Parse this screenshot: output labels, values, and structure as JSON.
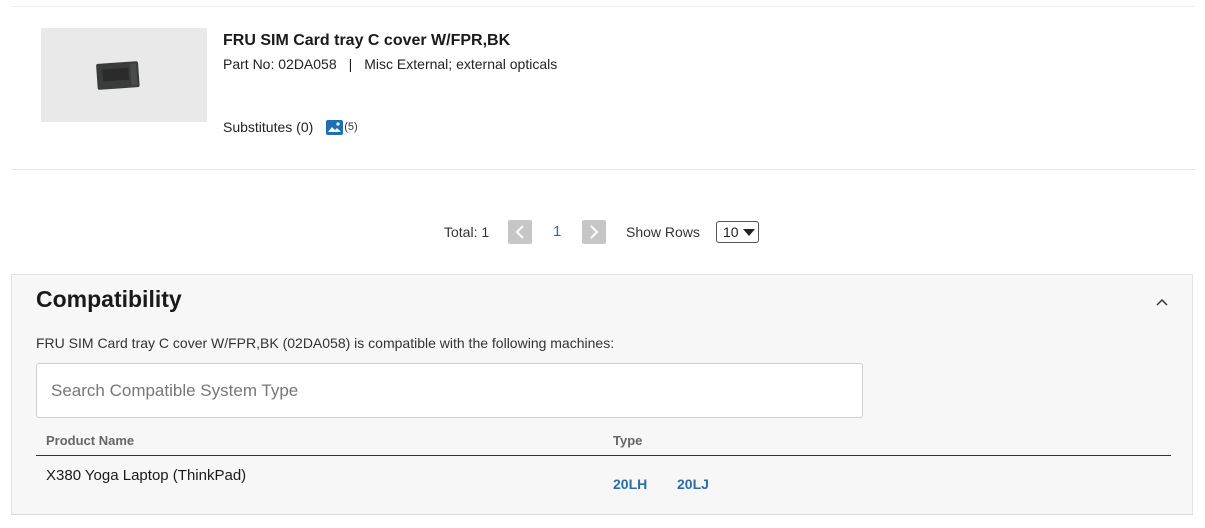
{
  "product": {
    "title": "FRU SIM Card tray C cover W/FPR,BK",
    "part_no": "Part No: 02DA058",
    "separator": "|",
    "category": "Misc External; external opticals",
    "substitutes": "Substitutes (0)",
    "image_count": "(5)"
  },
  "pagination": {
    "total": "Total: 1",
    "current_page": "1",
    "show_rows_label": "Show Rows",
    "rows_value": "10"
  },
  "compatibility": {
    "title": "Compatibility",
    "description": "FRU SIM Card tray C cover W/FPR,BK (02DA058) is compatible with the following machines:",
    "search_placeholder": "Search Compatible System Type",
    "columns": [
      "Product Name",
      "Type"
    ],
    "rows": [
      {
        "product_name": "X380 Yoga Laptop (ThinkPad)",
        "types": [
          "20LH",
          "20LJ"
        ]
      }
    ]
  },
  "colors": {
    "link": "#2a6ea8",
    "accent": "#1f6fb5",
    "panel_bg": "#f7f7f7"
  }
}
